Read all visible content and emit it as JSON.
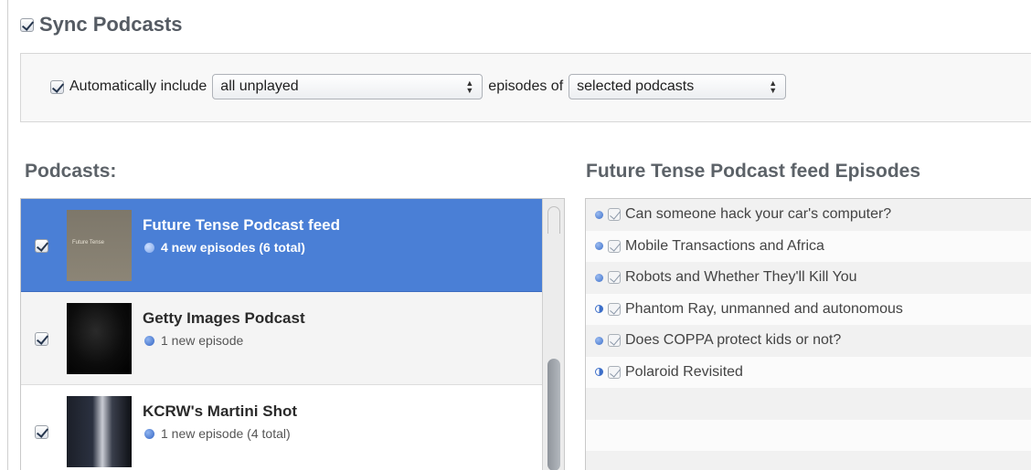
{
  "sync": {
    "title": "Sync Podcasts",
    "checked": true
  },
  "options": {
    "auto_label": "Automatically include",
    "auto_checked": true,
    "episodes_select": "all unplayed",
    "episodes_of_label": "episodes of",
    "podcasts_select": "selected podcasts"
  },
  "podcasts": {
    "heading": "Podcasts:",
    "items": [
      {
        "title": "Future Tense Podcast feed",
        "subtitle": "4 new episodes (6 total)",
        "thumb_text": "Future Tense",
        "selected": true,
        "checked": true
      },
      {
        "title": "Getty Images Podcast",
        "subtitle": "1 new episode",
        "selected": false,
        "checked": true
      },
      {
        "title": "KCRW's Martini Shot",
        "subtitle": "1 new episode (4 total)",
        "selected": false,
        "checked": true
      }
    ]
  },
  "episodes": {
    "heading": "Future Tense Podcast feed Episodes",
    "items": [
      {
        "title": "Can someone hack your car's computer?",
        "status": "unplayed"
      },
      {
        "title": "Mobile Transactions and Africa",
        "status": "unplayed"
      },
      {
        "title": "Robots and Whether They'll Kill You",
        "status": "unplayed"
      },
      {
        "title": "Phantom Ray, unmanned and autonomous",
        "status": "partially-played"
      },
      {
        "title": "Does COPPA protect kids or not?",
        "status": "unplayed"
      },
      {
        "title": "Polaroid Revisited",
        "status": "partially-played"
      }
    ]
  },
  "colors": {
    "selection": "#4a7fd6",
    "unplayed_dot": "#3d6fc9"
  }
}
